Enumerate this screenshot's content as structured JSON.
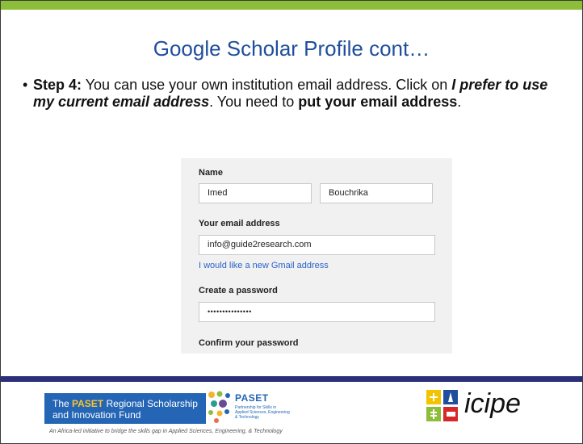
{
  "slide": {
    "title": "Google Scholar Profile cont…",
    "bullet": {
      "marker": "•",
      "step_label": "Step 4:",
      "text1": " You can use your own institution email address. Click on ",
      "emphasis1": "I prefer to use my current email address",
      "text2": ". You need to ",
      "emphasis2": "put your email address",
      "text3": "."
    },
    "colors": {
      "accent_green": "#8dbe3a",
      "title_blue": "#1f4e9c",
      "footer_bar": "#2b2f7a"
    }
  },
  "form": {
    "name_label": "Name",
    "first_name": "Imed",
    "last_name": "Bouchrika",
    "email_label": "Your email address",
    "email_value": "info@guide2research.com",
    "gmail_link": "I would like a new Gmail address",
    "password_label": "Create a password",
    "password_value": "•••••••••••••••",
    "confirm_label": "Confirm your password"
  },
  "footer": {
    "paset_banner_pre": "The ",
    "paset_banner_hl": "PASET",
    "paset_banner_post": " Regional Scholarship and Innovation Fund",
    "tagline": "An Africa-led initiative to bridge the skills gap in Applied Sciences, Engineering, & Technology",
    "paset_logo_text": "PASET",
    "paset_logo_sub": "Partnership for Skills in Applied Sciences, Engineering & Technology",
    "icipe_logo_text": "icipe"
  }
}
